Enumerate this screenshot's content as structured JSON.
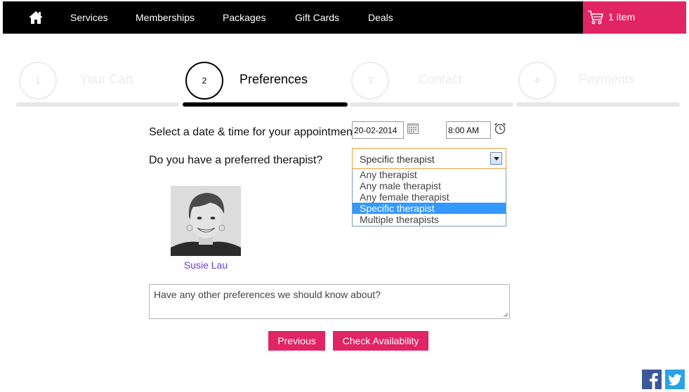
{
  "nav": {
    "home_icon": "home-icon",
    "items": [
      "Services",
      "Memberships",
      "Packages",
      "Gift Cards",
      "Deals"
    ],
    "cart_icon": "cart-icon",
    "cart_label": "1 item"
  },
  "steps": [
    {
      "number": "1",
      "label": "Your Cart",
      "active": false
    },
    {
      "number": "2",
      "label": "Preferences",
      "active": true
    },
    {
      "number": "3",
      "label": "Contact",
      "active": false
    },
    {
      "number": "4",
      "label": "Payments",
      "active": false
    }
  ],
  "form": {
    "date_question": "Select a date & time for your appointment",
    "date_value": "20-02-2014",
    "time_value": "8:00 AM",
    "therapist_question": "Do you have a preferred therapist?",
    "therapist_selected": "Specific therapist",
    "therapist_options": [
      "Any therapist",
      "Any male therapist",
      "Any female therapist",
      "Specific therapist",
      "Multiple therapists"
    ],
    "therapist_name": "Susie Lau",
    "preferences_placeholder": "Have any other preferences we should know about?"
  },
  "buttons": {
    "previous": "Previous",
    "check_availability": "Check Availability"
  },
  "social": [
    "facebook-icon",
    "twitter-icon"
  ],
  "colors": {
    "accent": "#e02464",
    "nav_bg": "#000000",
    "link": "#6a3cbf",
    "selection": "#3399ff",
    "facebook": "#3b5998",
    "twitter": "#2aa3e4"
  }
}
